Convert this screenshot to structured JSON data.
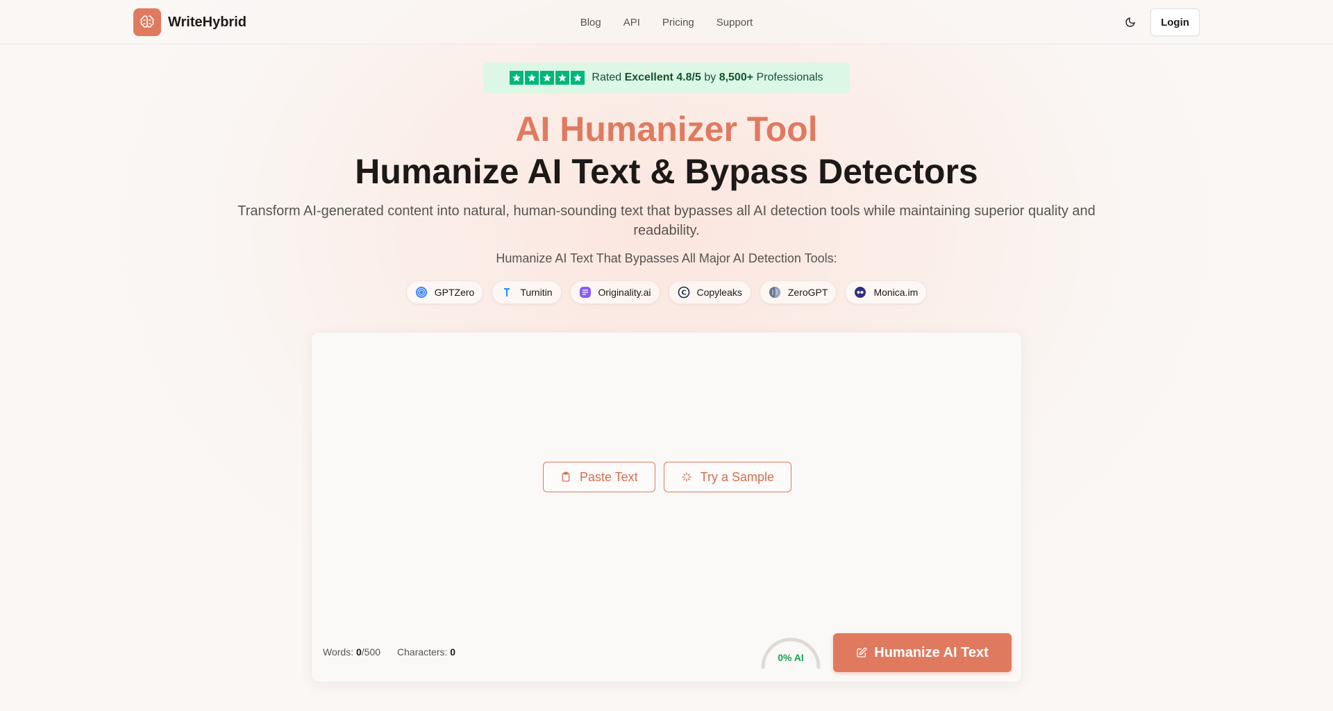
{
  "header": {
    "brand": "WriteHybrid",
    "nav": [
      "Blog",
      "API",
      "Pricing",
      "Support"
    ],
    "login_label": "Login"
  },
  "rating": {
    "stars": 5,
    "prefix": "Rated",
    "score": "Excellent 4.8/5",
    "by": "by",
    "count": "8,500+",
    "suffix": "Professionals"
  },
  "hero": {
    "accent_title": "AI Humanizer Tool",
    "title": "Humanize AI Text & Bypass Detectors",
    "subtitle": "Transform AI-generated content into natural, human-sounding text that bypasses all AI detection tools while maintaining superior quality and readability.",
    "detectors_label": "Humanize AI Text That Bypasses All Major AI Detection Tools:"
  },
  "detectors": [
    {
      "name": "GPTZero",
      "icon": "gptzero-icon"
    },
    {
      "name": "Turnitin",
      "icon": "turnitin-icon"
    },
    {
      "name": "Originality.ai",
      "icon": "originality-icon"
    },
    {
      "name": "Copyleaks",
      "icon": "copyleaks-icon"
    },
    {
      "name": "ZeroGPT",
      "icon": "zerogpt-icon"
    },
    {
      "name": "Monica.im",
      "icon": "monica-icon"
    }
  ],
  "editor": {
    "paste_label": "Paste Text",
    "sample_label": "Try a Sample",
    "words_label": "Words:",
    "words_value": "0",
    "words_limit": "/500",
    "chars_label": "Characters:",
    "chars_value": "0",
    "ai_score": "0% AI",
    "submit_label": "Humanize AI Text"
  },
  "colors": {
    "accent": "#e07a5f",
    "rating_bg": "#dcf7e6",
    "star": "#00b67a",
    "ai_ok": "#16a34a"
  }
}
